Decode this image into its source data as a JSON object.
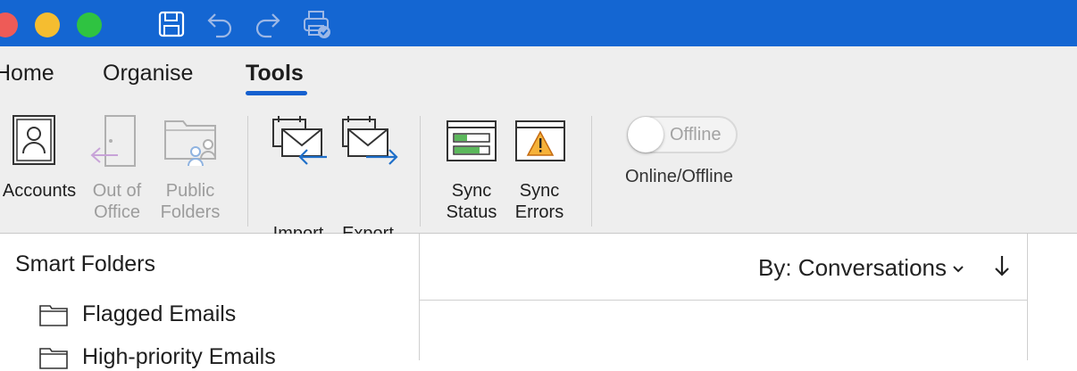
{
  "toolbar": {
    "icons": [
      "save-icon",
      "undo-icon",
      "redo-icon",
      "print-icon"
    ]
  },
  "tabs": [
    {
      "label": "Home",
      "active": false
    },
    {
      "label": "Organise",
      "active": false
    },
    {
      "label": "Tools",
      "active": true
    }
  ],
  "ribbon": {
    "accounts": "Accounts",
    "out_of_office": "Out of\nOffice",
    "public_folders": "Public\nFolders",
    "import": "Import",
    "export": "Export",
    "sync_status": "Sync\nStatus",
    "sync_errors": "Sync\nErrors",
    "offline_toggle": "Offline",
    "online_offline": "Online/Offline"
  },
  "sidebar": {
    "section": "Smart Folders",
    "items": [
      "Flagged Emails",
      "High-priority Emails"
    ]
  },
  "list": {
    "sort_label": "By: Conversations"
  },
  "colors": {
    "titlebar": "#1466d2",
    "ribbon_bg": "#eeeeee",
    "accent": "#1560cf"
  }
}
